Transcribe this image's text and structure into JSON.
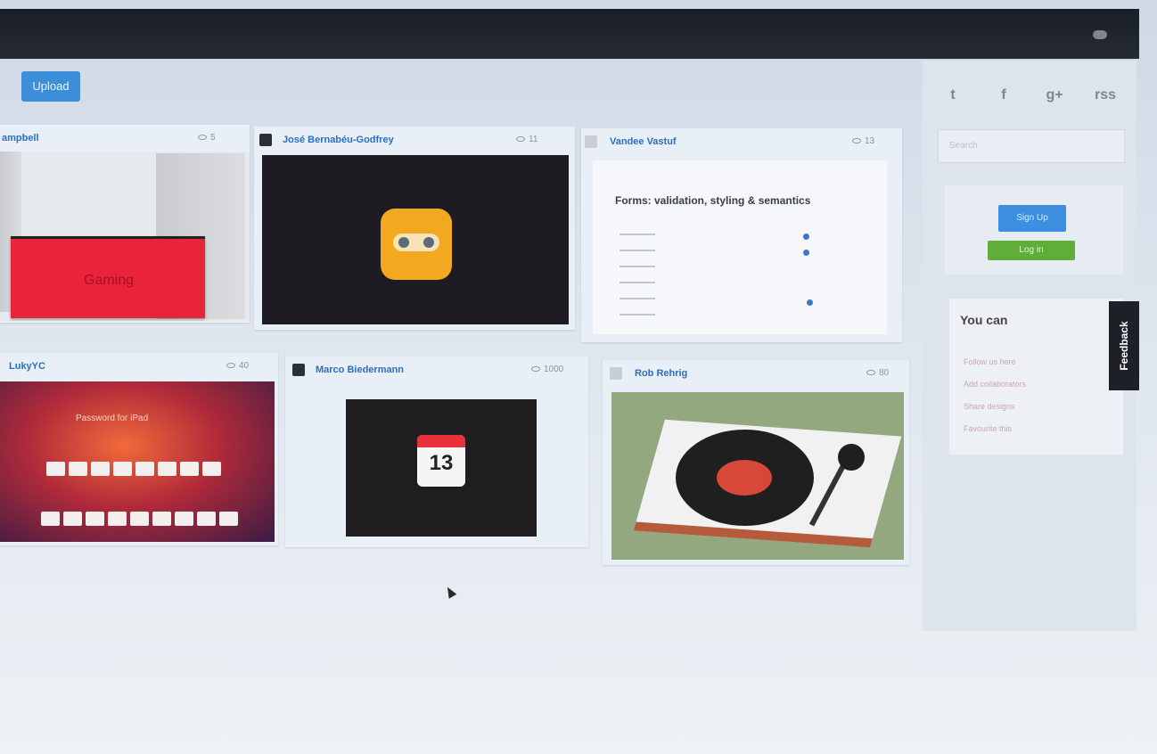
{
  "toolbar": {
    "button_label": "Upload"
  },
  "cards": [
    {
      "author": "ampbell",
      "views": "5",
      "thumb_text": "Gaming"
    },
    {
      "author": "José Bernabéu-Godfrey",
      "views": "11"
    },
    {
      "author": "Vandee Vastuf",
      "views": "13",
      "form_title": "Forms: validation, styling & semantics"
    },
    {
      "author": "LukyYC",
      "views": "40",
      "thumb_text": "Password for iPad"
    },
    {
      "author": "Marco Biedermann",
      "views": "1000",
      "calendar_day": "13"
    },
    {
      "author": "Rob Rehrig",
      "views": "80"
    }
  ],
  "sidebar": {
    "social": [
      "t",
      "f",
      "g+",
      "rss"
    ],
    "search_placeholder": "Search",
    "promo_primary": "Sign Up",
    "promo_secondary": "Log in",
    "you_can_title": "You can",
    "you_can_links": [
      "Follow us here",
      "Add collaborators",
      "Share designs",
      "Favourite this"
    ]
  },
  "feedback_label": "Feedback"
}
